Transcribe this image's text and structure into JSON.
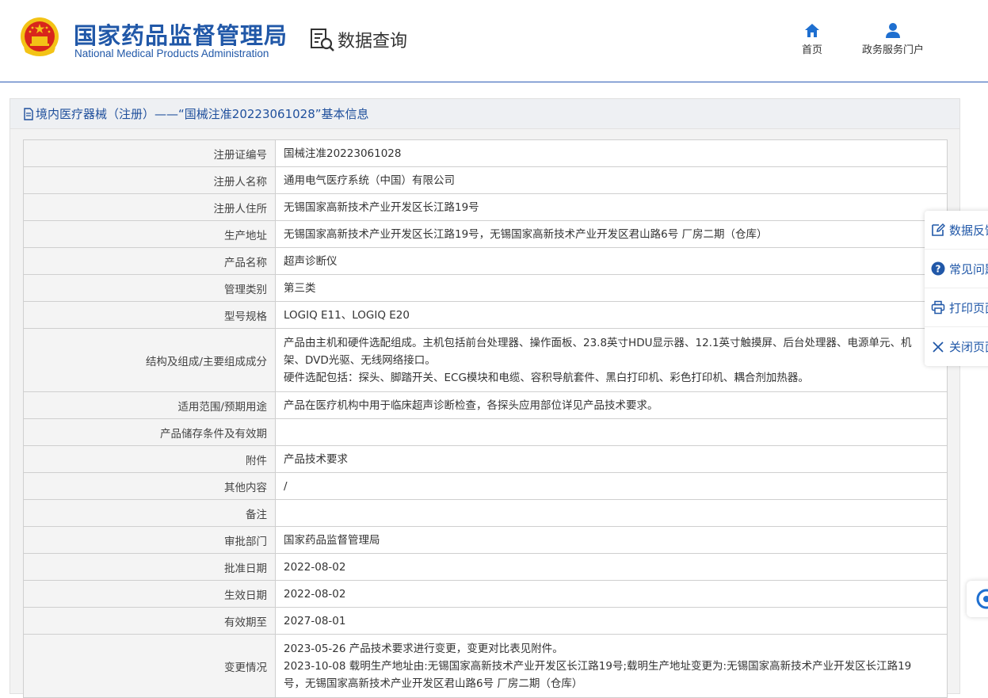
{
  "header": {
    "brand_cn": "国家药品监督管理局",
    "brand_en": "National Medical Products Administration",
    "query_title": "数据查询",
    "nav": [
      {
        "label": "首页",
        "icon": "home-icon"
      },
      {
        "label": "政务服务门户",
        "icon": "user-icon"
      }
    ]
  },
  "panel": {
    "title": "境内医疗器械（注册）——“国械注准20223061028”基本信息"
  },
  "rows": [
    {
      "key": "注册证编号",
      "value": "国械注准20223061028"
    },
    {
      "key": "注册人名称",
      "value": "通用电气医疗系统（中国）有限公司"
    },
    {
      "key": "注册人住所",
      "value": "无锡国家高新技术产业开发区长江路19号"
    },
    {
      "key": "生产地址",
      "value": "无锡国家高新技术产业开发区长江路19号，无锡国家高新技术产业开发区君山路6号 厂房二期（仓库）"
    },
    {
      "key": "产品名称",
      "value": "超声诊断仪"
    },
    {
      "key": "管理类别",
      "value": "第三类"
    },
    {
      "key": "型号规格",
      "value": "LOGIQ E11、LOGIQ E20"
    },
    {
      "key": "结构及组成/主要组成成分",
      "lines": [
        "产品由主机和硬件选配组成。主机包括前台处理器、操作面板、23.8英寸HDU显示器、12.1英寸触摸屏、后台处理器、电源单元、机",
        "架、DVD光驱、无线网络接口。",
        "硬件选配包括：探头、脚踏开关、ECG模块和电缆、容积导航套件、黑白打印机、彩色打印机、耦合剂加热器。"
      ]
    },
    {
      "key": "适用范围/预期用途",
      "value": "产品在医疗机构中用于临床超声诊断检查，各探头应用部位详见产品技术要求。"
    },
    {
      "key": "产品储存条件及有效期",
      "value": ""
    },
    {
      "key": "附件",
      "value": "产品技术要求"
    },
    {
      "key": "其他内容",
      "value": "/"
    },
    {
      "key": "备注",
      "value": ""
    },
    {
      "key": "审批部门",
      "value": "国家药品监督管理局"
    },
    {
      "key": "批准日期",
      "value": "2022-08-02"
    },
    {
      "key": "生效日期",
      "value": "2022-08-02"
    },
    {
      "key": "有效期至",
      "value": "2027-08-01"
    },
    {
      "key": "变更情况",
      "lines": [
        "2023-05-26 产品技术要求进行变更，变更对比表见附件。",
        "2023-10-08 载明生产地址由:无锡国家高新技术产业开发区长江路19号;载明生产地址变更为:无锡国家高新技术产业开发区长江路19",
        "号，无锡国家高新技术产业开发区君山路6号 厂房二期（仓库）"
      ]
    }
  ],
  "float_menu": [
    {
      "label": "数据反馈",
      "icon": "edit-icon"
    },
    {
      "label": "常见问题",
      "icon": "question-icon"
    },
    {
      "label": "打印页面",
      "icon": "print-icon"
    },
    {
      "label": "关闭页面",
      "icon": "close-icon"
    }
  ],
  "colors": {
    "brand": "#2158a8",
    "accent": "#1e6fd0",
    "emblem_red": "#d8261c",
    "emblem_gold": "#f3c316"
  }
}
